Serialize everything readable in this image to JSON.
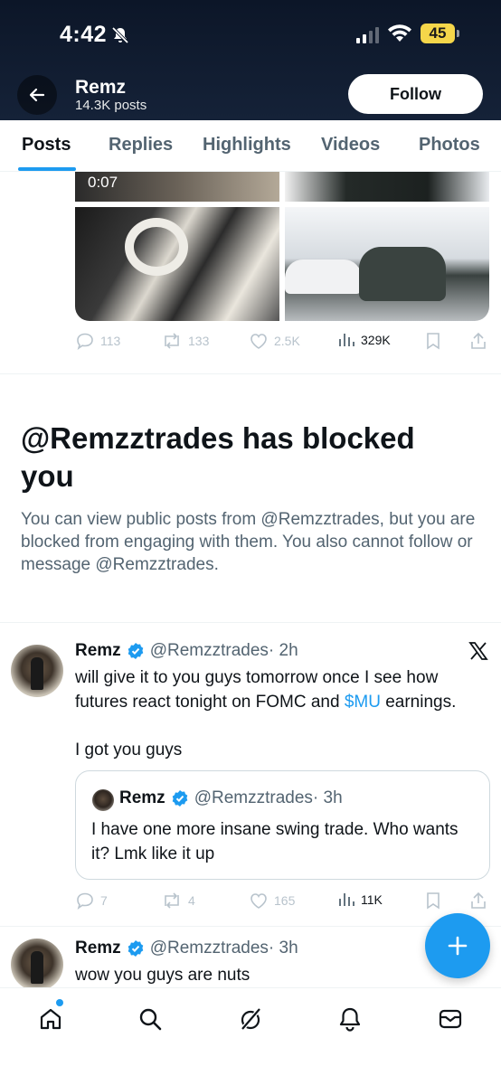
{
  "status_bar": {
    "time": "4:42",
    "battery": "45"
  },
  "header": {
    "back_label": "Back",
    "name": "Remz",
    "posts_count": "14.3K posts",
    "follow_label": "Follow"
  },
  "tabs": [
    {
      "label": "Posts",
      "active": true
    },
    {
      "label": "Replies"
    },
    {
      "label": "Highlights"
    },
    {
      "label": "Videos"
    },
    {
      "label": "Photos"
    }
  ],
  "media_post": {
    "video_time": "0:07",
    "replies": "113",
    "reposts": "133",
    "likes": "2.5K",
    "views": "329K"
  },
  "blocked": {
    "title": "@Remzztrades has blocked you",
    "body": "You can view public posts from @Remzztrades, but you are blocked from engaging with them. You also cannot follow or message @Remzztrades."
  },
  "tweet1": {
    "name": "Remz",
    "handle": "@Remzztrades",
    "time": "· 2h",
    "text_before": "will give it to you guys tomorrow once I see how futures react tonight on FOMC and ",
    "cashtag": "$MU",
    "text_after": " earnings.",
    "text_line2": "I got you guys",
    "quote": {
      "name": "Remz",
      "handle": "@Remzztrades",
      "time": "· 3h",
      "text": "I have one more insane swing trade. Who wants it? Lmk like it up"
    },
    "replies": "7",
    "reposts": "4",
    "likes": "165",
    "views": "11K"
  },
  "tweet2": {
    "name": "Remz",
    "handle": "@Remzztrades",
    "time": "· 3h",
    "text": "wow you guys are nuts"
  },
  "colors": {
    "accent": "#1d9bf0",
    "header_bg": "#0c1628",
    "muted": "#536471"
  }
}
